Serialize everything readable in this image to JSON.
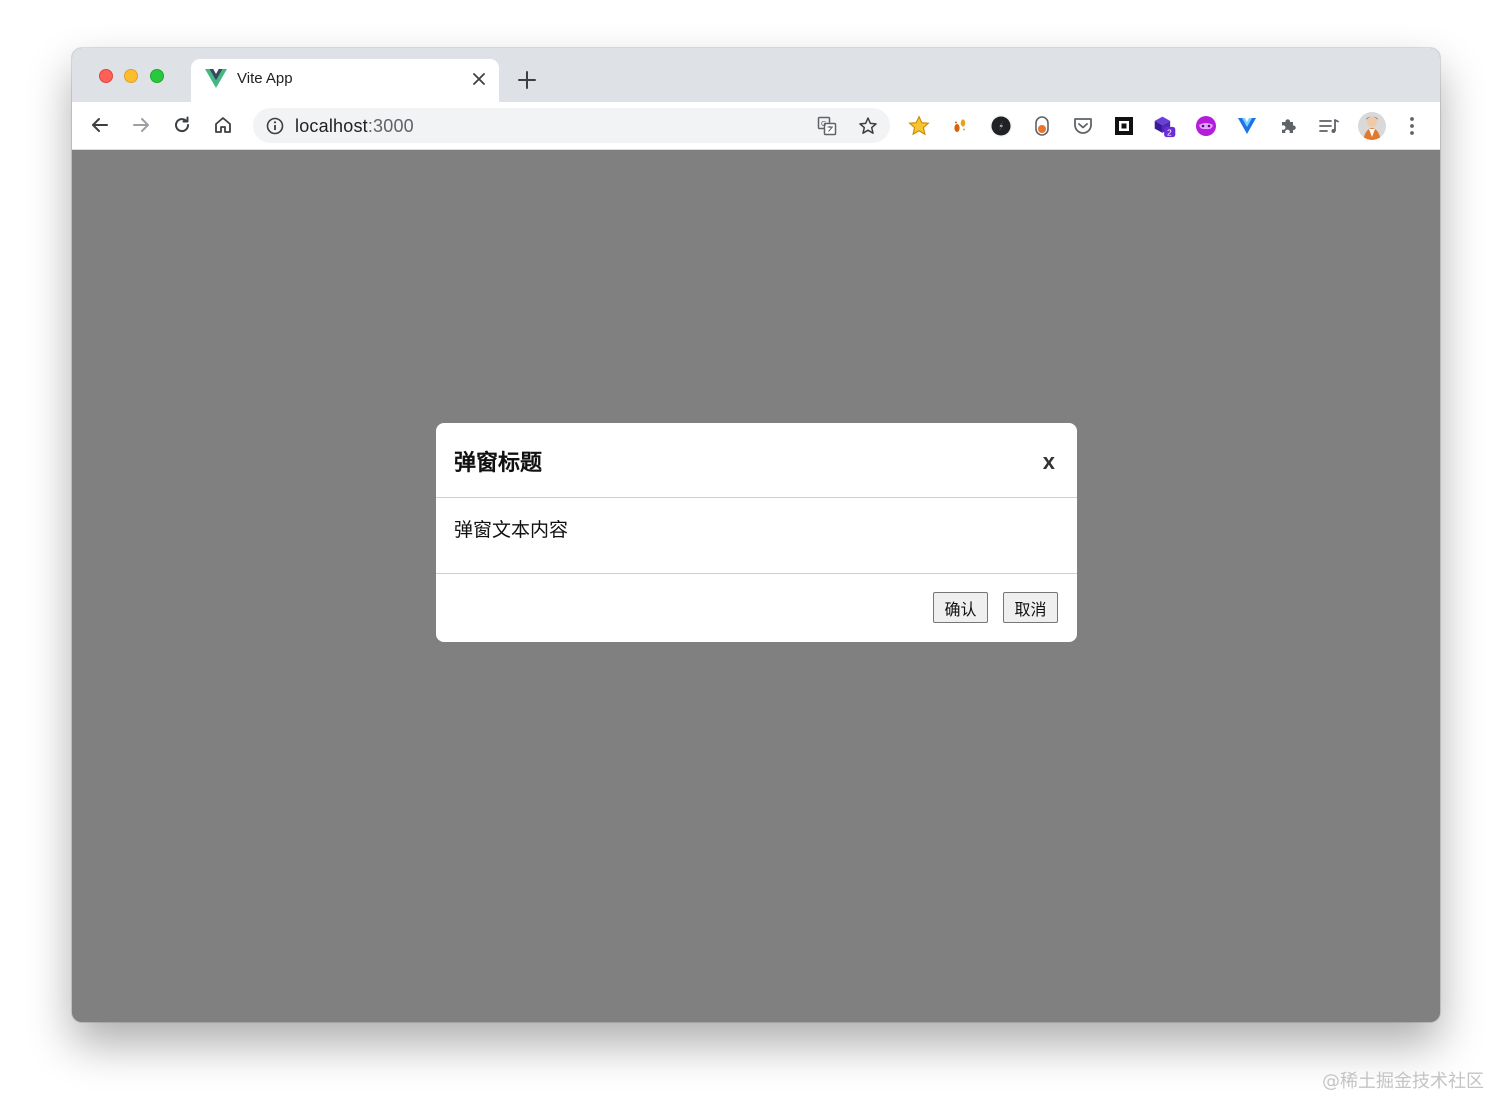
{
  "browser": {
    "tab_title": "Vite App",
    "url_host": "localhost",
    "url_port": ":3000"
  },
  "extensions": [
    {
      "name": "star-extension",
      "icon": "star-icon",
      "color": "#f5b400"
    },
    {
      "name": "footprint-extension",
      "icon": "footprint-icon",
      "color": "#d9620b"
    },
    {
      "name": "compass-extension",
      "icon": "compass-icon",
      "color": "#202124"
    },
    {
      "name": "capsule-extension",
      "icon": "capsule-icon",
      "color": "#e8742e"
    },
    {
      "name": "pocket-extension",
      "icon": "pocket-icon",
      "color": "#5f6368"
    },
    {
      "name": "square-extension",
      "icon": "square-icon",
      "color": "#111111"
    },
    {
      "name": "cube-extension",
      "icon": "cube-icon",
      "color": "#4a1fa8",
      "badge": "2"
    },
    {
      "name": "mask-extension",
      "icon": "mask-icon",
      "color": "#b31ddb"
    },
    {
      "name": "vue-devtools-extension",
      "icon": "v-shield-icon",
      "color": "#1a73e8"
    },
    {
      "name": "extensions-menu",
      "icon": "puzzle-icon",
      "color": "#5f6368"
    },
    {
      "name": "reading-list",
      "icon": "reading-list-icon",
      "color": "#5f6368"
    }
  ],
  "modal": {
    "title": "弹窗标题",
    "close_label": "x",
    "body_text": "弹窗文本内容",
    "confirm_label": "确认",
    "cancel_label": "取消"
  },
  "watermark": "@稀土掘金技术社区",
  "colors": {
    "overlay": "#808080",
    "titlebar": "#dee1e6",
    "vue_green": "#42b883",
    "vue_dark": "#35495e"
  }
}
